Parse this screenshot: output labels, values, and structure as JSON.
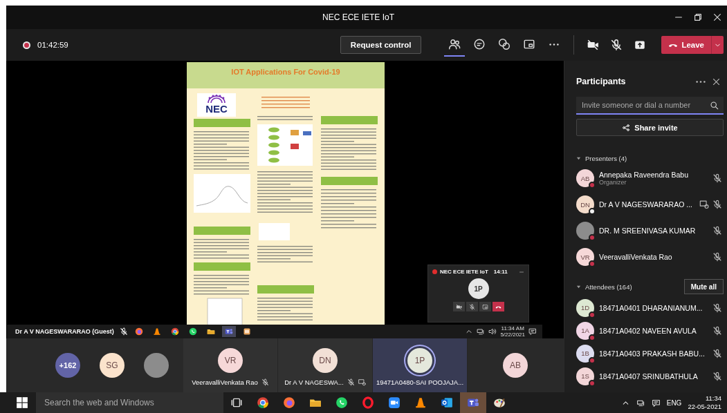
{
  "window": {
    "title": "NEC ECE IETE IoT"
  },
  "toolbar": {
    "recording": true,
    "elapsed": "01:42:59",
    "request_control": "Request control",
    "tools": [
      {
        "kind": "people",
        "selected": true
      },
      {
        "kind": "chat",
        "selected": false
      },
      {
        "kind": "reactions",
        "selected": false
      },
      {
        "kind": "rooms",
        "selected": false
      },
      {
        "kind": "more",
        "selected": false
      }
    ],
    "devices": [
      {
        "kind": "camera",
        "on": false
      },
      {
        "kind": "mic",
        "on": false
      },
      {
        "kind": "share"
      }
    ],
    "leave": "Leave"
  },
  "stage": {
    "poster": {
      "title": "IOT Applications For Covid-19",
      "logo_text": "NEC"
    },
    "mini_window": {
      "title": "NEC ECE IETE IoT",
      "timer": "14:11",
      "avatar": "1P"
    },
    "presenter_label": "Dr A V NAGESWARARAO (Guest)",
    "presenter_taskbar": {
      "apps": [
        {
          "kind": "firefox",
          "selected": false
        },
        {
          "kind": "vlc",
          "selected": false
        },
        {
          "kind": "chrome",
          "selected": false
        },
        {
          "kind": "whatsapp",
          "selected": false
        },
        {
          "kind": "explorer",
          "selected": false
        },
        {
          "kind": "teams",
          "selected": true
        },
        {
          "kind": "app",
          "selected": false
        }
      ],
      "time": "11:34 AM",
      "date": "5/22/2021"
    }
  },
  "gallery": [
    {
      "kind": "count",
      "label": "+162"
    },
    {
      "kind": "avatar",
      "initials": "SG",
      "color": "#fbe3cc"
    },
    {
      "kind": "photo"
    },
    {
      "kind": "tile",
      "initials": "VR",
      "color": "#f6d8d8",
      "name": "VeeravalliVenkata Rao",
      "muted": true,
      "sharing": false,
      "speaking": false
    },
    {
      "kind": "tile",
      "initials": "DN",
      "color": "#f2e0d6",
      "name": "Dr A V NAGESWA...",
      "muted": true,
      "sharing": true,
      "speaking": false
    },
    {
      "kind": "tile",
      "initials": "1P",
      "color": "#e4e8dc",
      "name": "19471A0480-SAI POOJAJA...",
      "muted": false,
      "sharing": false,
      "speaking": true
    },
    {
      "kind": "avatar",
      "initials": "AB",
      "color": "#f3d6d8"
    }
  ],
  "participants": {
    "title": "Participants",
    "invite_placeholder": "Invite someone or dial a number",
    "share_invite": "Share invite",
    "sections": [
      {
        "title": "Presenters (4)",
        "expanded": true,
        "people": [
          {
            "name": "Annepaka Raveendra Babu",
            "role": "Organizer",
            "avatar": {
              "kind": "initials",
              "initials": "AB",
              "color": "#f3d6d8"
            },
            "status": {
              "color": "#c4314b"
            },
            "muted": true,
            "sharing": false
          },
          {
            "name": "Dr A V NAGESWARARAO ...",
            "avatar": {
              "kind": "initials",
              "initials": "DN",
              "color": "#f4dccb"
            },
            "status": {
              "color": "#f0f0f0"
            },
            "muted": true,
            "sharing": true
          },
          {
            "name": "DR. M SREENIVASA KUMAR",
            "avatar": {
              "kind": "photo"
            },
            "status": {
              "color": "#c4314b"
            },
            "muted": true,
            "sharing": false
          },
          {
            "name": "VeeravalliVenkata Rao",
            "avatar": {
              "kind": "initials",
              "initials": "VR",
              "color": "#f6d8d8"
            },
            "status": {
              "color": "#c4314b"
            },
            "muted": true,
            "sharing": false
          }
        ]
      },
      {
        "title": "Attendees (164)",
        "expanded": true,
        "action": "Mute all",
        "people": [
          {
            "name": "18471A0401 DHARANIANUM...",
            "avatar": {
              "kind": "initials",
              "initials": "1D",
              "color": "#dde8d2"
            },
            "status": {
              "color": "#c4314b"
            },
            "muted": true,
            "sharing": false
          },
          {
            "name": "18471A0402 NAVEEN AVULA",
            "avatar": {
              "kind": "initials",
              "initials": "1A",
              "color": "#f1d6e6"
            },
            "status": {
              "color": "#c4314b"
            },
            "muted": true,
            "sharing": false
          },
          {
            "name": "18471A0403 PRAKASH BABU...",
            "avatar": {
              "kind": "initials",
              "initials": "1B",
              "color": "#dcdcf0"
            },
            "status": {
              "color": "#c4314b"
            },
            "muted": true,
            "sharing": false
          },
          {
            "name": "18471A0407 SRINUBATHULA",
            "avatar": {
              "kind": "initials",
              "initials": "1S",
              "color": "#f3d6d8"
            },
            "status": {
              "color": "#c4314b"
            },
            "muted": true,
            "sharing": false
          }
        ]
      }
    ]
  },
  "taskbar": {
    "search_placeholder": "Search the web and Windows",
    "apps": [
      {
        "kind": "taskview",
        "selected": false
      },
      {
        "kind": "chrome",
        "selected": false
      },
      {
        "kind": "firefox",
        "selected": false
      },
      {
        "kind": "explorer",
        "selected": false
      },
      {
        "kind": "whatsapp",
        "selected": false
      },
      {
        "kind": "opera",
        "selected": false
      },
      {
        "kind": "zoom",
        "selected": false
      },
      {
        "kind": "vlc",
        "selected": false
      },
      {
        "kind": "outlook",
        "selected": false
      },
      {
        "kind": "teams",
        "selected": true
      },
      {
        "kind": "paint",
        "selected": false
      }
    ],
    "language": "ENG",
    "time": "11:34",
    "date": "22-05-2021"
  }
}
